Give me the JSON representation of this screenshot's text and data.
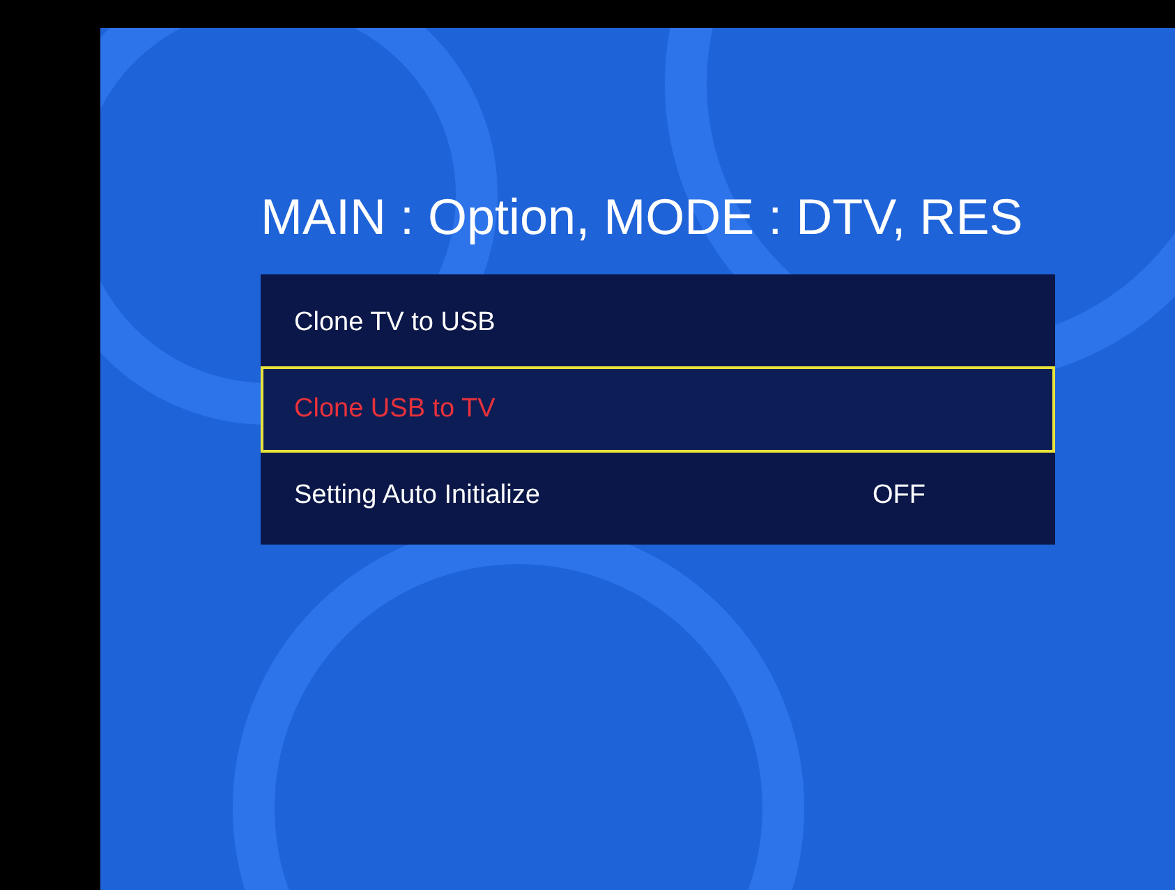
{
  "header": {
    "text": "MAIN : Option, MODE : DTV, RES"
  },
  "menu": {
    "items": [
      {
        "label": "Clone TV to USB",
        "selected": false
      },
      {
        "label": "Clone USB to TV",
        "selected": true
      },
      {
        "label": "Setting Auto Initialize",
        "value": "OFF",
        "selected": false
      }
    ]
  }
}
